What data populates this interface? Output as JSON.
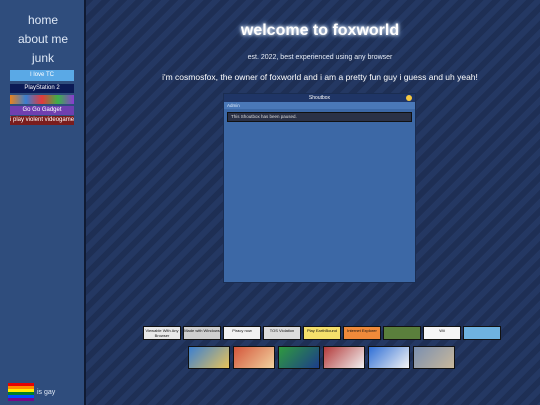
{
  "sidebar": {
    "nav": [
      {
        "label": "home"
      },
      {
        "label": "about me"
      },
      {
        "label": "junk"
      }
    ],
    "stamps": [
      {
        "text": "I love TC",
        "bg": "#5aa9e6"
      },
      {
        "text": "PlayStation 2",
        "bg": "#0b1a55"
      },
      {
        "text": "",
        "bg": "#e8821e"
      },
      {
        "text": "Go Go Gadget",
        "bg": "#6f3fb0"
      },
      {
        "text": "i play violent videogames",
        "bg": "#7a1d1d"
      }
    ],
    "footer_text": "is gay"
  },
  "header": {
    "title": "welcome to foxworld",
    "subtitle": "est. 2022, best experienced using any browser",
    "intro": "i'm cosmosfox, the owner of foxworld and i am a pretty fun guy i guess and uh yeah!"
  },
  "shoutbox": {
    "title": "Shoutbox",
    "admin_label": "Admin",
    "message": "This Shoutbox has been paused."
  },
  "buttons_row1": [
    {
      "text": "Viewable With Any Browser",
      "bg": "#e9e9e9"
    },
    {
      "text": "Made with Windows",
      "bg": "#cfcfcf"
    },
    {
      "text": "Piracy now",
      "bg": "#f2f2f2"
    },
    {
      "text": "TOS Violation",
      "bg": "#dddddd"
    },
    {
      "text": "Play EarthBound",
      "bg": "#f5e06b"
    },
    {
      "text": "Internet Explorer",
      "bg": "#f08a3a"
    },
    {
      "text": "",
      "bg": "#5a7f3c"
    },
    {
      "text": "Wii",
      "bg": "#f5f5f5"
    },
    {
      "text": "",
      "bg": "#6fb3e0"
    }
  ],
  "buttons_row2": [
    {
      "bg": "#3b7fd0"
    },
    {
      "bg": "#d4563a"
    },
    {
      "bg": "#2f9a3e"
    },
    {
      "bg": "#b33a3a"
    },
    {
      "bg": "#2f6fd6"
    },
    {
      "bg": "#7a8fb0"
    }
  ],
  "colors": {
    "background": "#1e2f55",
    "sidebar": "#2f4d7d",
    "shoutbox": "#3c68a6"
  }
}
